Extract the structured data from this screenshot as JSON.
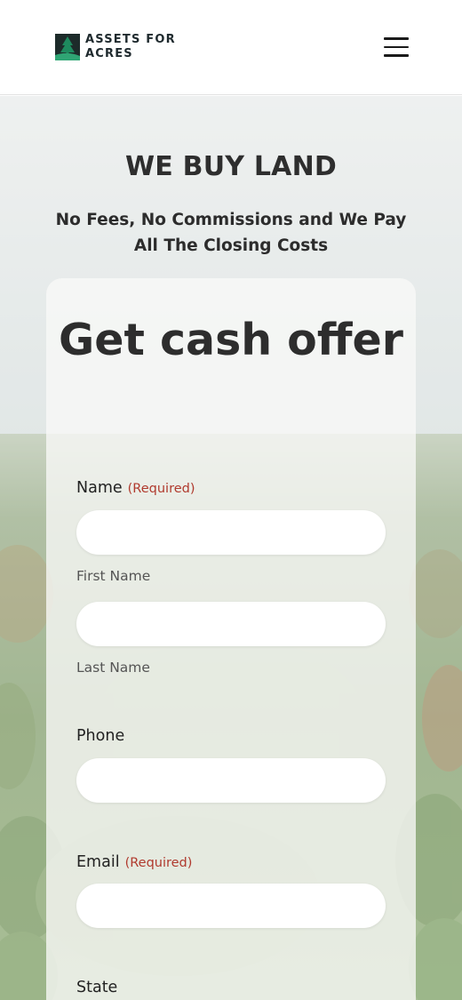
{
  "header": {
    "logo_line1": "ASSETS FOR",
    "logo_line2": "ACRES",
    "menu_icon": "hamburger-menu-icon"
  },
  "hero": {
    "title": "WE BUY LAND",
    "subtitle": "No Fees, No Commissions and We Pay All The Closing Costs"
  },
  "form": {
    "title": "Get cash offer",
    "required_label": "(Required)",
    "name_label": "Name",
    "first_name_sublabel": "First Name",
    "last_name_sublabel": "Last Name",
    "phone_label": "Phone",
    "email_label": "Email",
    "state_label": "State",
    "first_name_value": "",
    "last_name_value": "",
    "phone_value": "",
    "email_value": ""
  },
  "colors": {
    "required": "#b03a2e",
    "logo_green": "#1e8a5e",
    "text_dark": "#2d2d2d"
  }
}
